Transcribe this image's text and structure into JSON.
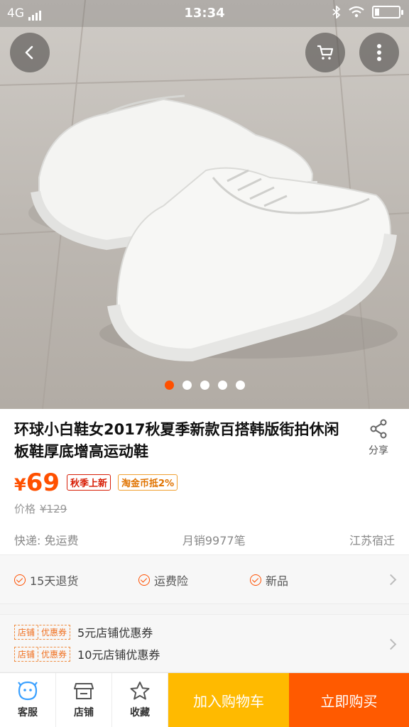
{
  "status_bar": {
    "network": "4G",
    "time": "13:34"
  },
  "product": {
    "title": "环球小白鞋女2017秋夏季新款百搭韩版街拍休闲板鞋厚底增高运动鞋",
    "currency": "¥",
    "price": "69",
    "tags": [
      "秋季上新",
      "淘金币抵2%"
    ],
    "original_price_label": "价格",
    "original_price": "¥129",
    "shipping": "快递: 免运费",
    "monthly_sales": "月销9977笔",
    "location": "江苏宿迁"
  },
  "share_label": "分享",
  "carousel": {
    "count": 5,
    "active_index": 0
  },
  "services": [
    "15天退货",
    "运费险",
    "新品"
  ],
  "coupons": [
    {
      "badge_left": "店铺",
      "badge_right": "优惠券",
      "text": "5元店铺优惠券"
    },
    {
      "badge_left": "店铺",
      "badge_right": "优惠券",
      "text": "10元店铺优惠券"
    }
  ],
  "bottom_bar": {
    "service_label": "客服",
    "shop_label": "店铺",
    "favorite_label": "收藏",
    "add_cart_label": "加入购物车",
    "buy_now_label": "立即购买"
  },
  "colors": {
    "accent": "#ff5000",
    "cart_button": "#ffba00",
    "buy_button": "#ff5a00"
  }
}
